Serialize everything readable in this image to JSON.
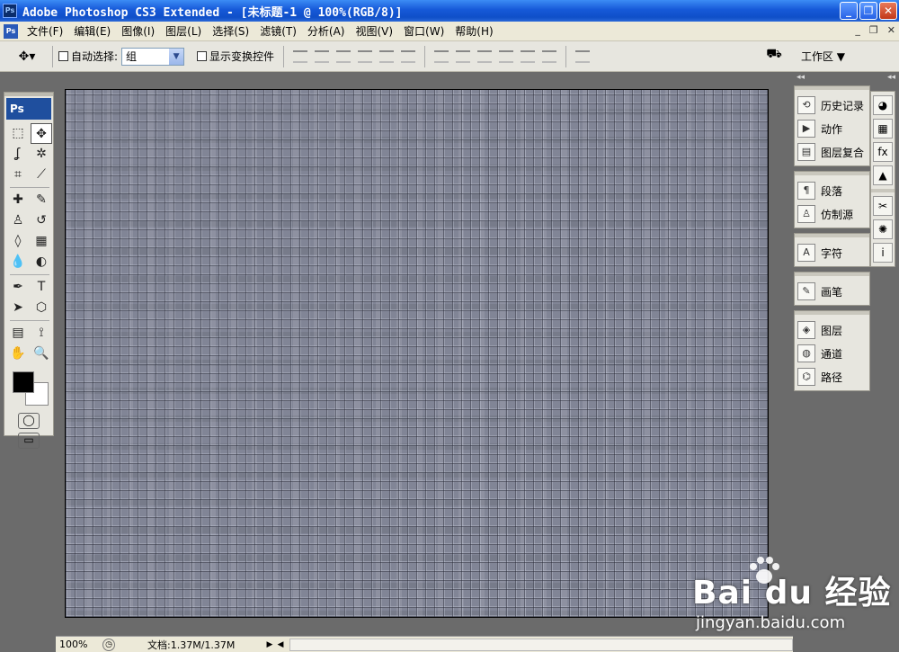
{
  "window": {
    "title": "Adobe Photoshop CS3 Extended - [未标题-1 @ 100%(RGB/8)]",
    "app_icon": "Ps",
    "minimize": "_",
    "maximize": "❐",
    "close": "✕"
  },
  "menubar": {
    "icon": "Ps",
    "items": [
      "文件(F)",
      "编辑(E)",
      "图像(I)",
      "图层(L)",
      "选择(S)",
      "滤镜(T)",
      "分析(A)",
      "视图(V)",
      "窗口(W)",
      "帮助(H)"
    ],
    "doc_buttons": [
      "_",
      "❐",
      "✕"
    ]
  },
  "options_bar": {
    "auto_select_label": "自动选择:",
    "auto_select_checked": false,
    "auto_select_value": "组",
    "show_transform_label": "显示变换控件",
    "show_transform_checked": false,
    "workspace_label": "工作区 ▼"
  },
  "toolbox": {
    "logo": "Ps",
    "tools": [
      {
        "name": "marquee-tool",
        "glyph": "⬚"
      },
      {
        "name": "move-tool",
        "glyph": "✥",
        "active": true
      },
      {
        "name": "lasso-tool",
        "glyph": "ʆ"
      },
      {
        "name": "magic-wand-tool",
        "glyph": "✲"
      },
      {
        "name": "crop-tool",
        "glyph": "⌗"
      },
      {
        "name": "slice-tool",
        "glyph": "⟋"
      },
      {
        "name": "healing-brush-tool",
        "glyph": "✚"
      },
      {
        "name": "brush-tool",
        "glyph": "✎"
      },
      {
        "name": "clone-stamp-tool",
        "glyph": "♙"
      },
      {
        "name": "history-brush-tool",
        "glyph": "↺"
      },
      {
        "name": "eraser-tool",
        "glyph": "◊"
      },
      {
        "name": "gradient-tool",
        "glyph": "▦"
      },
      {
        "name": "blur-tool",
        "glyph": "💧"
      },
      {
        "name": "dodge-tool",
        "glyph": "◐"
      },
      {
        "name": "pen-tool",
        "glyph": "✒"
      },
      {
        "name": "type-tool",
        "glyph": "T"
      },
      {
        "name": "path-selection-tool",
        "glyph": "➤"
      },
      {
        "name": "shape-tool",
        "glyph": "⬡"
      },
      {
        "name": "notes-tool",
        "glyph": "▤"
      },
      {
        "name": "eyedropper-tool",
        "glyph": "⟟"
      },
      {
        "name": "hand-tool",
        "glyph": "✋"
      },
      {
        "name": "zoom-tool",
        "glyph": "🔍"
      }
    ],
    "colors": {
      "foreground": "#000000",
      "background": "#ffffff"
    },
    "quick_mask": "◯",
    "screen_mode": "▭"
  },
  "status_bar": {
    "zoom": "100%",
    "doc_info": "文档:1.37M/1.37M",
    "arrow": "▶"
  },
  "panels": {
    "groups": [
      [
        {
          "label": "历史记录",
          "icon": "history-icon",
          "glyph": "⟲"
        },
        {
          "label": "动作",
          "icon": "actions-icon",
          "glyph": "▶"
        },
        {
          "label": "图层复合",
          "icon": "layer-comps-icon",
          "glyph": "▤"
        }
      ],
      [
        {
          "label": "段落",
          "icon": "paragraph-icon",
          "glyph": "¶"
        },
        {
          "label": "仿制源",
          "icon": "clone-source-icon",
          "glyph": "♙"
        }
      ],
      [
        {
          "label": "字符",
          "icon": "character-icon",
          "glyph": "A"
        }
      ],
      [
        {
          "label": "画笔",
          "icon": "brushes-icon",
          "glyph": "✎"
        }
      ],
      [
        {
          "label": "图层",
          "icon": "layers-icon",
          "glyph": "◈"
        },
        {
          "label": "通道",
          "icon": "channels-icon",
          "glyph": "◍"
        },
        {
          "label": "路径",
          "icon": "paths-icon",
          "glyph": "⌬"
        }
      ]
    ],
    "icon_column": [
      {
        "name": "color-icon",
        "glyph": "◕"
      },
      {
        "name": "swatches-icon",
        "glyph": "▦"
      },
      {
        "name": "styles-icon",
        "glyph": "fx"
      },
      {
        "name": "histogram-icon",
        "glyph": "▲"
      },
      {
        "name": "tool-presets-icon",
        "glyph": "✂"
      },
      {
        "name": "navigator-icon",
        "glyph": "✺"
      },
      {
        "name": "info-icon",
        "glyph": "i"
      }
    ]
  },
  "watermark": {
    "main": "Bai du 经验",
    "sub": "jingyan.baidu.com"
  }
}
